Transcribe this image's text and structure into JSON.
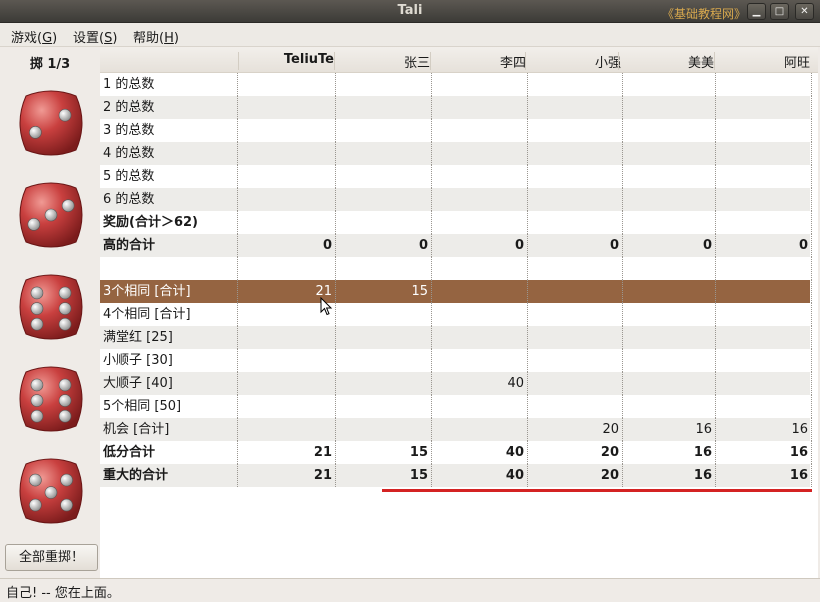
{
  "window": {
    "title": "Tali",
    "watermark": "《基础教程网》",
    "buttons": {
      "minimize": "▁",
      "maximize": "□",
      "close": "✕"
    }
  },
  "menubar": {
    "items": [
      {
        "label": "游戏(",
        "mnemonic": "G",
        "suffix": ")"
      },
      {
        "label": "设置(",
        "mnemonic": "S",
        "suffix": ")"
      },
      {
        "label": "帮助(",
        "mnemonic": "H",
        "suffix": ")"
      }
    ]
  },
  "left_panel": {
    "roll_label": "掷 1/3",
    "dice": [
      2,
      3,
      6,
      6,
      5
    ],
    "reroll_button": "全部重掷！",
    "dice_color": "#c9403f"
  },
  "table": {
    "headers": [
      "TeliuTe",
      "张三",
      "李四",
      "小强",
      "美美",
      "阿旺"
    ],
    "rows": [
      {
        "label": "1 的总数",
        "bold": false,
        "values": [
          "",
          "",
          "",
          "",
          "",
          ""
        ]
      },
      {
        "label": "2 的总数",
        "bold": false,
        "values": [
          "",
          "",
          "",
          "",
          "",
          ""
        ]
      },
      {
        "label": "3 的总数",
        "bold": false,
        "values": [
          "",
          "",
          "",
          "",
          "",
          ""
        ]
      },
      {
        "label": "4 的总数",
        "bold": false,
        "values": [
          "",
          "",
          "",
          "",
          "",
          ""
        ]
      },
      {
        "label": "5 的总数",
        "bold": false,
        "values": [
          "",
          "",
          "",
          "",
          "",
          ""
        ]
      },
      {
        "label": "6 的总数",
        "bold": false,
        "values": [
          "",
          "",
          "",
          "",
          "",
          ""
        ]
      },
      {
        "label": "奖励(合计＞62)",
        "bold": true,
        "values": [
          "",
          "",
          "",
          "",
          "",
          ""
        ]
      },
      {
        "label": "高的合计",
        "bold": true,
        "values": [
          "0",
          "0",
          "0",
          "0",
          "0",
          "0"
        ]
      },
      {
        "label": "",
        "bold": false,
        "values": [
          "",
          "",
          "",
          "",
          "",
          ""
        ]
      },
      {
        "label": "3个相同 [合计]",
        "bold": false,
        "selected": true,
        "values": [
          "21",
          "15",
          "",
          "",
          "",
          ""
        ]
      },
      {
        "label": "4个相同 [合计]",
        "bold": false,
        "values": [
          "",
          "",
          "",
          "",
          "",
          ""
        ]
      },
      {
        "label": "满堂红 [25]",
        "bold": false,
        "values": [
          "",
          "",
          "",
          "",
          "",
          ""
        ]
      },
      {
        "label": "小顺子 [30]",
        "bold": false,
        "values": [
          "",
          "",
          "",
          "",
          "",
          ""
        ]
      },
      {
        "label": "大顺子 [40]",
        "bold": false,
        "values": [
          "",
          "",
          "40",
          "",
          "",
          ""
        ]
      },
      {
        "label": "5个相同 [50]",
        "bold": false,
        "values": [
          "",
          "",
          "",
          "",
          "",
          ""
        ]
      },
      {
        "label": "机会 [合计]",
        "bold": false,
        "values": [
          "",
          "",
          "",
          "20",
          "16",
          "16"
        ]
      },
      {
        "label": "低分合计",
        "bold": true,
        "values": [
          "21",
          "15",
          "40",
          "20",
          "16",
          "16"
        ]
      },
      {
        "label": "重大的合计",
        "bold": true,
        "values": [
          "21",
          "15",
          "40",
          "20",
          "16",
          "16"
        ]
      }
    ],
    "selected_color": "#956441",
    "highlight_line_color": "#d42323"
  },
  "statusbar": {
    "text": "自己! -- 您在上面。"
  }
}
